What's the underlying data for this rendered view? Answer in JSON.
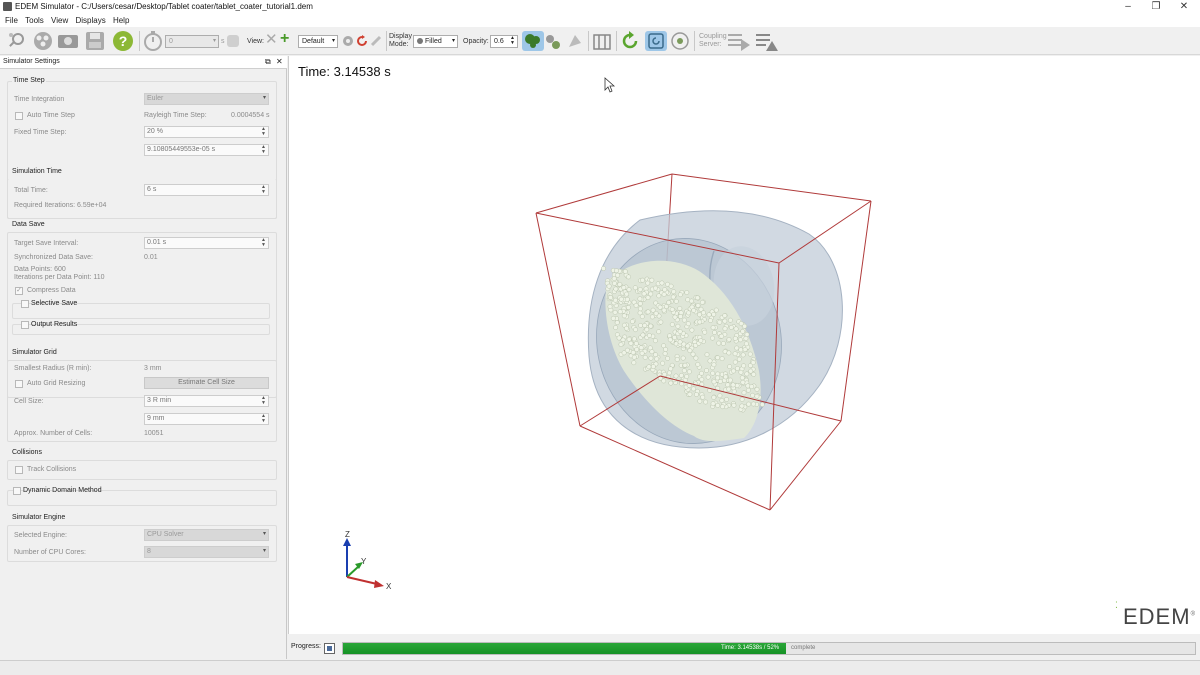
{
  "window": {
    "title": "EDEM Simulator - C:/Users/cesar/Desktop/Tablet coater/tablet_coater_tutorial1.dem",
    "minimize": "–",
    "restore": "❐",
    "close": "✕"
  },
  "menu": [
    "File",
    "Tools",
    "View",
    "Displays",
    "Help"
  ],
  "toolbar": {
    "step_value": "0",
    "step_unit": "s",
    "view_label": "View:",
    "view_combo": "Default",
    "display_mode_label": "Display Mode:",
    "display_mode_value": "Filled",
    "opacity_label": "Opacity:",
    "opacity_value": "0.6",
    "coupling_label": "Coupling Server:"
  },
  "panel": {
    "title": "Simulator Settings",
    "time_step": {
      "header": "Time Step",
      "integration_label": "Time Integration",
      "integration_value": "Euler",
      "auto_label": "Auto Time Step",
      "rayleigh_label": "Rayleigh Time Step:",
      "rayleigh_value": "0.0004554 s",
      "fixed_label": "Fixed Time Step:",
      "fixed_percent": "20 %",
      "fixed_seconds": "9.10805449553e-05 s"
    },
    "simulation_time": {
      "header": "Simulation Time",
      "total_label": "Total Time:",
      "total_value": "6 s",
      "required_iterations": "Required Iterations: 6.59e+04"
    },
    "data_save": {
      "header": "Data Save",
      "interval_label": "Target Save Interval:",
      "interval_value": "0.01 s",
      "sync_label": "Synchronized Data Save:",
      "sync_value": "0.01",
      "data_points": "Data Points: 600",
      "iterations_per_point": "Iterations per Data Point: 110",
      "compress_label": "Compress Data",
      "selective_label": "Selective Save",
      "output_label": "Output Results"
    },
    "grid": {
      "header": "Simulator Grid",
      "radius_label": "Smallest Radius (R min):",
      "radius_value": "3 mm",
      "auto_label": "Auto Grid Resizing",
      "estimate_button": "Estimate Cell Size",
      "cell_label": "Cell Size:",
      "cell_r": "3 R min",
      "cell_mm": "9 mm",
      "cells_label": "Approx. Number of Cells:",
      "cells_value": "10051"
    },
    "collisions": {
      "header": "Collisions",
      "track_label": "Track Collisions"
    },
    "dynamic_domain_label": "Dynamic Domain Method",
    "engine": {
      "header": "Simulator Engine",
      "selected_label": "Selected Engine:",
      "selected_value": "CPU Solver",
      "cores_label": "Number of CPU Cores:",
      "cores_value": "8"
    }
  },
  "viewport": {
    "time_text": "Time: 3.14538 s",
    "axis_z": "Z",
    "axis_y": "Y",
    "axis_x": "X",
    "logo": "EDEM",
    "logo_mark": "®"
  },
  "progress": {
    "label": "Progress:",
    "fraction": 0.52,
    "text": "Time: 3.14538s / 52%",
    "suffix": "complete"
  }
}
